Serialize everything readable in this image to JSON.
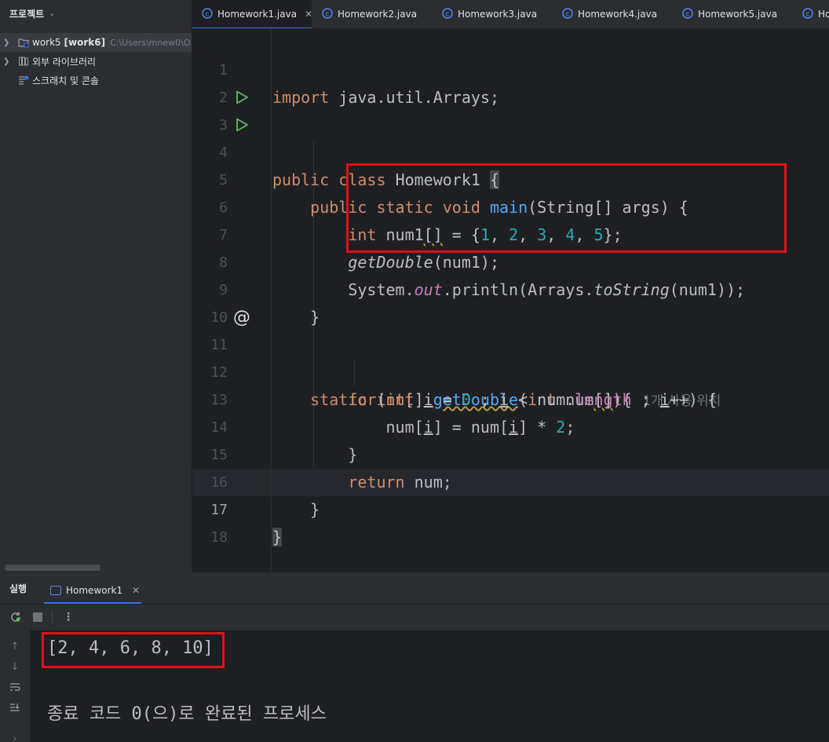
{
  "project_panel": {
    "title": "프로젝트",
    "items": [
      {
        "label": "work5",
        "module": "[work6]",
        "path": "C:\\Users\\mnew0\\O"
      },
      {
        "label": "외부 라이브러리"
      },
      {
        "label": "스크래치 및 콘솔"
      }
    ]
  },
  "tabs": [
    {
      "label": "Homework1.java",
      "active": true
    },
    {
      "label": "Homework2.java"
    },
    {
      "label": "Homework3.java"
    },
    {
      "label": "Homework4.java"
    },
    {
      "label": "Homework5.java"
    },
    {
      "label": "Ho"
    }
  ],
  "editor": {
    "line_numbers": [
      "1",
      "2",
      "3",
      "4",
      "5",
      "6",
      "7",
      "8",
      "9",
      "10",
      "11",
      "12",
      "13",
      "14",
      "15",
      "16",
      "17",
      "18"
    ],
    "current_line": 17,
    "usage_hint": "1개 사용 위치",
    "code": {
      "l1_import": "import",
      "l1_rest": " java.util.Arrays;",
      "l3_public": "public",
      "l3_class": "class",
      "l3_name": "Homework1 ",
      "l3_brace": "{",
      "l4_mods": "public static void",
      "l4_main": "main",
      "l4_rest": "(String[] args) {",
      "l6_int": "int",
      "l6_var": " num1",
      "l6_arr": "[]",
      "l6_eq": " = {",
      "l6_n1": "1",
      "l6_n2": "2",
      "l6_n3": "3",
      "l6_n4": "4",
      "l6_n5": "5",
      "l6_comma": ", ",
      "l6_end": "};",
      "l7_call": "getDouble",
      "l7_rest": "(num1);",
      "l8_sys": "System.",
      "l8_out": "out",
      "l8_println": ".println(Arrays.",
      "l8_tostring": "toString",
      "l8_rest": "(num1));",
      "l9": "}",
      "l11_mods": "static int",
      "l11_arr": "[] ",
      "l11_name": "getDouble",
      "l11_open": "(",
      "l11_int": "int",
      "l11_param": " num",
      "l11_br": "[]",
      "l11_close": "){",
      "l12_for": "for",
      "l12_open": "(",
      "l12_int": "int",
      "l12_i": "i",
      "l12_eq": " = ",
      "l12_zero": "0",
      "l12_semi": " ; ",
      "l12_lt": " < num.",
      "l12_length": "length",
      "l12_semi2": " ; ",
      "l12_inc": "++) {",
      "l13_a": "num[",
      "l13_i": "i",
      "l13_b": "] = num[",
      "l13_c": "] * ",
      "l13_two": "2",
      "l13_end": ";",
      "l14": "}",
      "l15_return": "return",
      "l15_rest": " num;",
      "l16": "}",
      "l17": "}"
    }
  },
  "run": {
    "title": "실행",
    "tab_label": "Homework1",
    "output_line": "[2, 4, 6, 8, 10]",
    "exit_line": "종료 코드 0(으)로 완료된 프로세스"
  }
}
